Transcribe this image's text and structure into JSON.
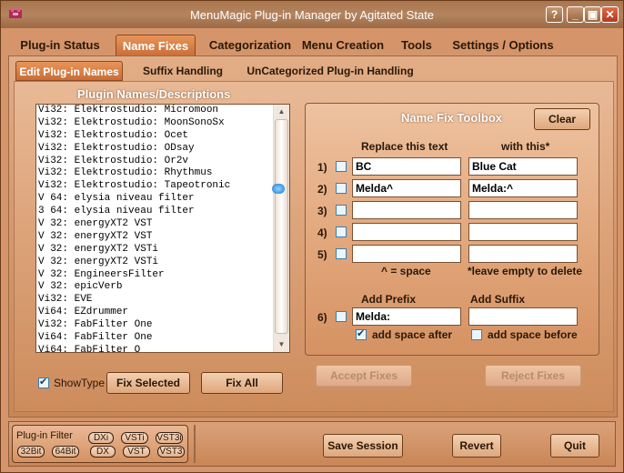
{
  "window": {
    "title": "MenuMagic Plug-in Manager by Agitated State",
    "controls": [
      "help",
      "minimize",
      "maximize",
      "close"
    ],
    "help_label": "?",
    "minimize_label": "_",
    "maximize_label": "▣",
    "close_label": "✕"
  },
  "tabs": [
    "Plug-in Status",
    "Name Fixes",
    "Categorization",
    "Menu Creation",
    "Tools",
    "Settings / Options"
  ],
  "active_tab": "Name Fixes",
  "subtabs": [
    "Edit Plug-in Names",
    "Suffix Handling",
    "UnCategorized Plug-in Handling"
  ],
  "active_subtab": "Edit Plug-in Names",
  "plugin_list": {
    "header": "Plugin Names/Descriptions",
    "items": [
      "Vi32: Elektrostudio: Micromoon",
      "Vi32: Elektrostudio: MoonSonoSx",
      "Vi32: Elektrostudio: Ocet",
      "Vi32: Elektrostudio: ODsay",
      "Vi32: Elektrostudio: Or2v",
      "Vi32: Elektrostudio: Rhythmus",
      "Vi32: Elektrostudio: Tapeotronic",
      "V 64: elysia niveau filter",
      "3 64: elysia niveau filter",
      "V 32: energyXT2 VST",
      "V 32: energyXT2 VST",
      "V 32: energyXT2 VSTi",
      "V 32: energyXT2 VSTi",
      "V 32: EngineersFilter",
      "V 32: epicVerb",
      "Vi32: EVE",
      "Vi64: EZdrummer",
      "Vi32: FabFilter One",
      "Vi64: FabFilter One",
      "Vi64: FabFilter O"
    ],
    "showtype_label": "ShowType",
    "showtype_checked": true,
    "fix_selected_label": "Fix Selected",
    "fix_all_label": "Fix All"
  },
  "toolbox": {
    "title": "Name Fix Toolbox",
    "clear_label": "Clear",
    "replace_header": "Replace this text",
    "with_header": "with this*",
    "rows": [
      {
        "num": "1)",
        "replace": "BC",
        "with": "Blue Cat",
        "checked": false
      },
      {
        "num": "2)",
        "replace": "Melda^",
        "with": "Melda:^",
        "checked": false
      },
      {
        "num": "3)",
        "replace": "",
        "with": "",
        "checked": false
      },
      {
        "num": "4)",
        "replace": "",
        "with": "",
        "checked": false
      },
      {
        "num": "5)",
        "replace": "",
        "with": "",
        "checked": false
      }
    ],
    "space_note": "^ = space",
    "delete_note": "*leave empty to delete",
    "prefix_header": "Add Prefix",
    "suffix_header": "Add Suffix",
    "row6_num": "6)",
    "prefix_value": "Melda:",
    "suffix_value": "",
    "add_space_after_label": "add space after",
    "add_space_after_checked": true,
    "add_space_before_label": "add space before",
    "add_space_before_checked": false
  },
  "accept_label": "Accept Fixes",
  "reject_label": "Reject Fixes",
  "filter": {
    "label": "Plug-in Filter",
    "pills_row1": [
      "DXi",
      "VSTi",
      "VST3i"
    ],
    "pills_row2": [
      "32Bit",
      "64Bit",
      "DX",
      "VST",
      "VST3"
    ]
  },
  "bottom": {
    "save_label": "Save Session",
    "revert_label": "Revert",
    "quit_label": "Quit"
  }
}
